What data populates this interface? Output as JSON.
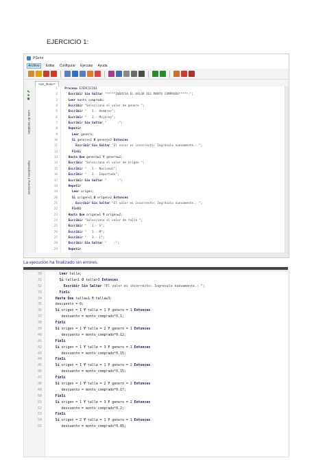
{
  "doc_title": "EJERCICIO 1:",
  "window": {
    "title": "PSeInt"
  },
  "menu": [
    "Archivo",
    "Editar",
    "Configurar",
    "Ejecutar",
    "Ayuda"
  ],
  "tab_label": "<sin_titulo>*",
  "side_labels": {
    "variables": "Lista de Variables",
    "operators": "Operadores y Funciones"
  },
  "toolbar_colors": [
    "#d88a2a",
    "#e5a000",
    "#cc3a2a",
    "#cc3a2a",
    "#5b7fb8",
    "#2d6fd1",
    "#5b7fb8",
    "#e07a2a",
    "#d44",
    "#aa3a8a",
    "#3a6fba",
    "#8a8a8a",
    "#6a6a6a",
    "#4a4a4a",
    "#2a8a2a",
    "#2a8a2a",
    "#d86a2a",
    "#cc3a2a",
    "#b03030"
  ],
  "code1": [
    {
      "n": "1",
      "t": "  Proceso EJERCICIO1"
    },
    {
      "n": "2",
      "t": "    Escribir Sin Saltar \"*****INGRESA EL VALOR DEL MONTO COMPRADO*****:\";"
    },
    {
      "n": "3",
      "t": "    Leer monto_comprado;"
    },
    {
      "n": "4",
      "t": "    Escribir \"Selecciona el valor de genero \";"
    },
    {
      "n": "5",
      "t": "    Escribir \"   1.- Hombres\";"
    },
    {
      "n": "6",
      "t": "    Escribir \"   2.- Mujeres\";"
    },
    {
      "n": "7",
      "t": "    Escribir Sin Saltar \"      :\";"
    },
    {
      "n": "8",
      "t": "    Repetir"
    },
    {
      "n": "9",
      "t": "      Leer genero;"
    },
    {
      "n": "10",
      "t": "      Si genero<1 O genero>2 Entonces"
    },
    {
      "n": "11",
      "t": "        Escribir Sin Saltar \"El valor es incorrecto: Ingrésalo nuevamente.: \";"
    },
    {
      "n": "12",
      "t": "      FinSi"
    },
    {
      "n": "13",
      "t": "    Hasta Que genero≥1 Y genero≤2;"
    },
    {
      "n": "14",
      "t": "    Escribir \"Selecciona el valor de origen \";"
    },
    {
      "n": "15",
      "t": "    Escribir \"   1.- Nacional\";"
    },
    {
      "n": "16",
      "t": "    Escribir \"   2.- Importado\";"
    },
    {
      "n": "17",
      "t": "    Escribir Sin Saltar \"      :\";"
    },
    {
      "n": "18",
      "t": "    Repetir"
    },
    {
      "n": "19",
      "t": "      Leer origen;"
    },
    {
      "n": "20",
      "t": "      Si origen<1 O origen>2 Entonces"
    },
    {
      "n": "21",
      "t": "        Escribir Sin Saltar \"El valor es incorrecto: Ingrésalo nuevamente.: \";"
    },
    {
      "n": "22",
      "t": "      FinSi"
    },
    {
      "n": "23",
      "t": "    Hasta Que origen≥1 Y origen≤2;"
    },
    {
      "n": "24",
      "t": "    Escribir \"Selecciona el valor de talla \";"
    },
    {
      "n": "25",
      "t": "    Escribir \"   1.- S\";"
    },
    {
      "n": "26",
      "t": "    Escribir \"   2.- M\";"
    },
    {
      "n": "27",
      "t": "    Escribir \"   3.- L\";"
    },
    {
      "n": "28",
      "t": "    Escribir Sin Saltar \"    :\";"
    },
    {
      "n": "29",
      "t": "    Repetir"
    }
  ],
  "status_text": "La ejecución ha finalizado sin errores.",
  "code2": [
    {
      "n": "30",
      "t": "      Leer talla;"
    },
    {
      "n": "31",
      "t": "      Si talla<1 O talla>3 Entonces"
    },
    {
      "n": "32",
      "t": "        Escribir Sin Saltar \"El valor es incorrecto: Ingrésalo nuevamente.: \";"
    },
    {
      "n": "33",
      "t": "      FinSi"
    },
    {
      "n": "34",
      "t": "    Hasta Que talla≥1 Y talla≤3;"
    },
    {
      "n": "35",
      "t": "    descuento = 0;"
    },
    {
      "n": "36",
      "t": "    Si origen = 1 Y talla = 1 Y genero = 1 Entonces"
    },
    {
      "n": "37",
      "t": "       descuento = monto_comprado*0.1;"
    },
    {
      "n": "38",
      "t": "    FinSi"
    },
    {
      "n": "39",
      "t": "    Si origen = 1 Y talla = 2 Y genero = 1 Entonces"
    },
    {
      "n": "40",
      "t": "       descuento = monto_comprado*0.12;"
    },
    {
      "n": "41",
      "t": "    FinSi"
    },
    {
      "n": "42",
      "t": "    Si origen = 1 Y talla = 3 Y genero = 1 Entonces"
    },
    {
      "n": "43",
      "t": "       descuento = monto_comprado*0.15;"
    },
    {
      "n": "44",
      "t": "    FinSi"
    },
    {
      "n": "45",
      "t": "    Si origen = 1 Y talla = 1 Y genero = 2 Entonces"
    },
    {
      "n": "46",
      "t": "       descuento = monto_comprado*0.15;"
    },
    {
      "n": "47",
      "t": "    FinSi"
    },
    {
      "n": "48",
      "t": "    Si origen = 1 Y talla = 2 Y genero = 2 Entonces"
    },
    {
      "n": "49",
      "t": "       descuento = monto_comprado*0.17;"
    },
    {
      "n": "50",
      "t": "    FinSi"
    },
    {
      "n": "51",
      "t": "    Si origen = 1 Y talla = 3 Y genero = 2 Entonces"
    },
    {
      "n": "52",
      "t": "       descuento = monto_comprado*0.2;"
    },
    {
      "n": "53",
      "t": "    FinSi"
    },
    {
      "n": "54",
      "t": "    Si origen = 2 Y talla = 1 Y genero = 1 Entonces"
    },
    {
      "n": "55",
      "t": "       descuento = monto_comprado*0.05;"
    }
  ]
}
